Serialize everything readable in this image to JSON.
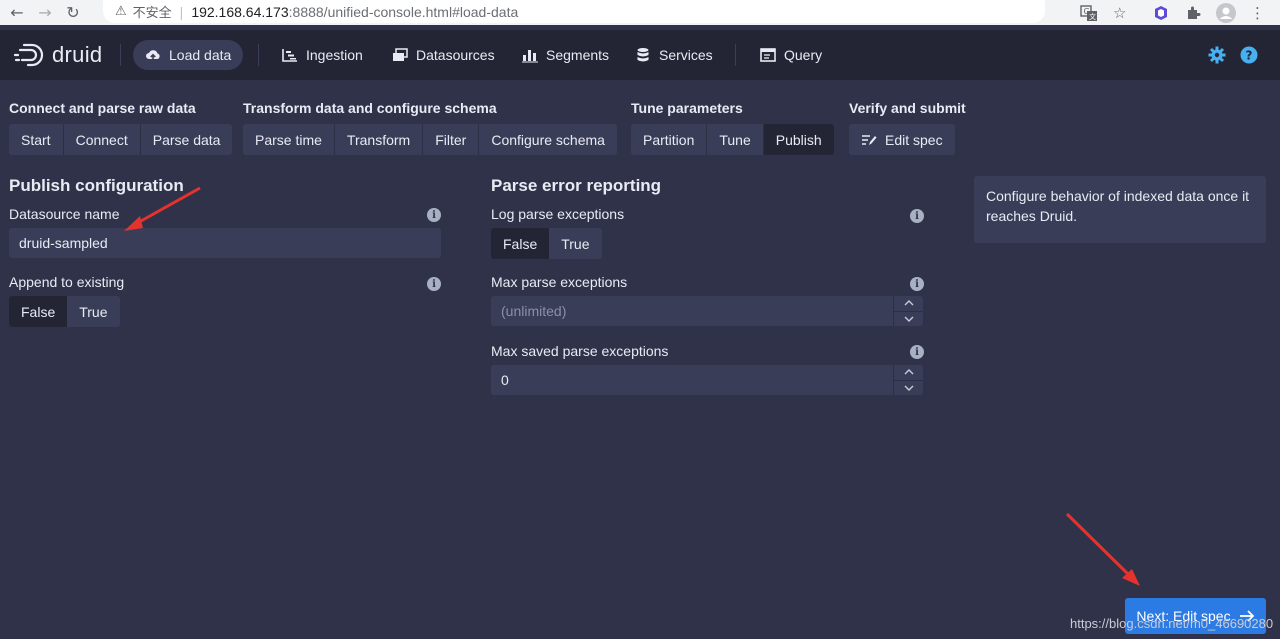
{
  "browser": {
    "insecure_label": "不安全",
    "url_host": "192.168.64.173",
    "url_path": ":8888/unified-console.html#load-data"
  },
  "header": {
    "logo_text": "druid",
    "nav": [
      {
        "label": "Load data",
        "icon": "cloud-upload-icon",
        "active": true
      },
      {
        "label": "Ingestion",
        "icon": "gantt-chart-icon"
      },
      {
        "label": "Datasources",
        "icon": "multi-select-icon"
      },
      {
        "label": "Segments",
        "icon": "stacked-chart-icon"
      },
      {
        "label": "Services",
        "icon": "database-icon"
      },
      {
        "label": "Query",
        "icon": "application-icon"
      }
    ],
    "accent_color": "#2c7be5",
    "icon_color": "#48aff0"
  },
  "steps": [
    {
      "title": "Connect and parse raw data",
      "buttons": [
        "Start",
        "Connect",
        "Parse data"
      ]
    },
    {
      "title": "Transform data and configure schema",
      "buttons": [
        "Parse time",
        "Transform",
        "Filter",
        "Configure schema"
      ]
    },
    {
      "title": "Tune parameters",
      "buttons": [
        "Partition",
        "Tune",
        "Publish"
      ],
      "active": "Publish"
    },
    {
      "title": "Verify and submit",
      "buttons": [
        "Edit spec"
      ]
    }
  ],
  "publish": {
    "title": "Publish configuration",
    "datasource_label": "Datasource name",
    "datasource_value": "druid-sampled",
    "append_label": "Append to existing",
    "append_options": [
      "False",
      "True"
    ],
    "append_selected": "True"
  },
  "parse_errors": {
    "title": "Parse error reporting",
    "log_label": "Log parse exceptions",
    "log_options": [
      "False",
      "True"
    ],
    "log_selected": "True",
    "max_label": "Max parse exceptions",
    "max_placeholder": "(unlimited)",
    "saved_label": "Max saved parse exceptions",
    "saved_value": "0"
  },
  "help_text": "Configure behavior of indexed data once it reaches Druid.",
  "next_button": "Next: Edit spec",
  "watermark": "https://blog.csdn.net/m0_46690280"
}
